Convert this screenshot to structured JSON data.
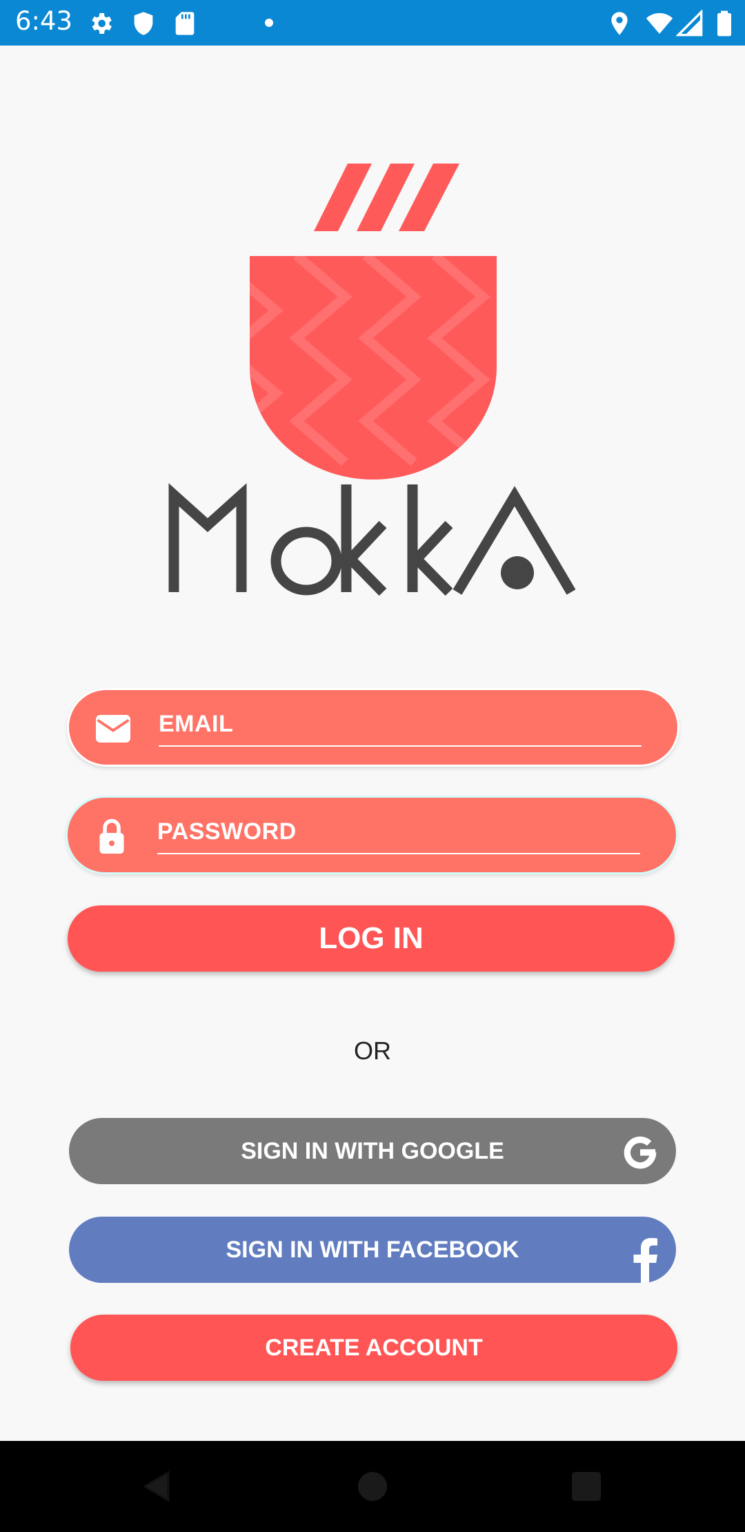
{
  "status_bar": {
    "time": "6:43",
    "left_icons": [
      "gear-icon",
      "shield-icon",
      "sd-card-icon",
      "notification-dot"
    ],
    "right_icons": [
      "location-icon",
      "wifi-icon",
      "signal-icon",
      "battery-icon"
    ]
  },
  "logo": {
    "wordmark": "MOKKA",
    "colors": {
      "cup": "#ff5a5a",
      "text": "#454545"
    }
  },
  "form": {
    "email_placeholder": "EMAIL",
    "password_placeholder": "PASSWORD",
    "login_label": "LOG IN",
    "or_label": "OR"
  },
  "social": {
    "google_label": "SIGN IN WITH GOOGLE",
    "facebook_label": "SIGN IN WITH FACEBOOK",
    "create_label": "CREATE ACCOUNT"
  },
  "nav_bar": {
    "buttons": [
      "back-icon",
      "home-icon",
      "recents-icon"
    ]
  },
  "colors": {
    "status_bar": "#0a88d4",
    "field": "#ff7367",
    "primary": "#ff5555",
    "google": "#7a7a7a",
    "facebook": "#617dc0"
  }
}
